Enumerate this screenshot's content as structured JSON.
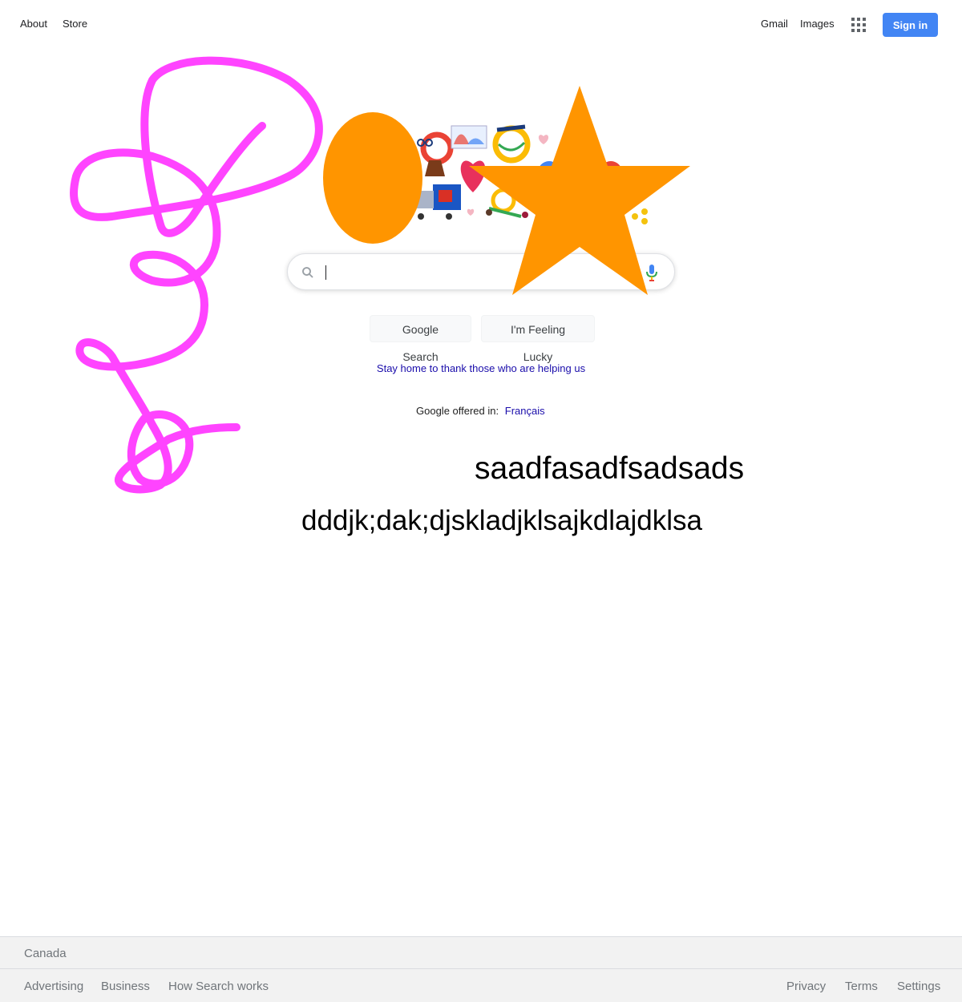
{
  "header": {
    "about": "About",
    "store": "Store",
    "gmail": "Gmail",
    "images": "Images",
    "apps_icon": "apps-grid-icon",
    "sign_in": "Sign in"
  },
  "doodle": {
    "icon": "google-doodle-stay-home"
  },
  "search": {
    "value": "",
    "search_icon": "search-icon",
    "mic_icon": "mic-icon"
  },
  "buttons": {
    "search": "Google Search",
    "lucky": "I'm Feeling Lucky"
  },
  "promo": "Stay home to thank those who are helping us",
  "offered": {
    "label": "Google offered in:",
    "language": "Français"
  },
  "annotations": {
    "text1": "saadfasadfsadsads",
    "text2": "dddjk;dak;djskladjklsajkdlajdklsa",
    "scribble_color": "#ff44ff",
    "shape_color": "#ff9500"
  },
  "footer": {
    "country": "Canada",
    "advertising": "Advertising",
    "business": "Business",
    "how_search": "How Search works",
    "privacy": "Privacy",
    "terms": "Terms",
    "settings": "Settings"
  },
  "colors": {
    "sign_in_bg": "#4285f4",
    "link": "#1a0dab",
    "footer_bg": "#f2f2f2"
  }
}
